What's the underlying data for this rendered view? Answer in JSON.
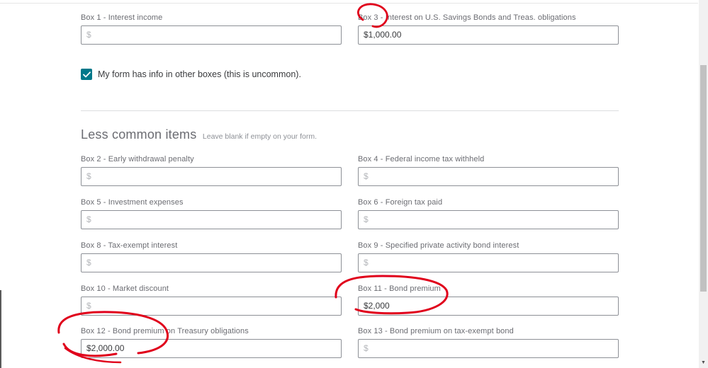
{
  "top_fields": [
    {
      "label": "Box 1 - Interest income",
      "value": "$",
      "empty": true
    },
    {
      "label": "Box 3 - Interest on U.S. Savings Bonds and Treas. obligations",
      "value": "$1,000.00",
      "empty": false
    }
  ],
  "checkbox": {
    "checked": true,
    "label": "My form has info in other boxes (this is uncommon)."
  },
  "section": {
    "title": "Less common items",
    "subtitle": "Leave blank if empty on your form."
  },
  "fields": {
    "box2": {
      "label": "Box 2 - Early withdrawal penalty",
      "value": "$"
    },
    "box4": {
      "label": "Box 4 - Federal income tax withheld",
      "value": "$"
    },
    "box5": {
      "label": "Box 5 - Investment expenses",
      "value": "$"
    },
    "box6": {
      "label": "Box 6 - Foreign tax paid",
      "value": "$"
    },
    "box8": {
      "label": "Box 8 - Tax-exempt interest",
      "value": "$"
    },
    "box9": {
      "label": "Box 9 - Specified private activity bond interest",
      "value": "$"
    },
    "box10": {
      "label": "Box 10 - Market discount",
      "value": "$"
    },
    "box11": {
      "label": "Box 11 - Bond premium",
      "value": "$2,000"
    },
    "box12": {
      "label": "Box 12 - Bond premium on Treasury obligations",
      "value": "$2,000.00"
    },
    "box13": {
      "label": "Box 13 - Bond premium on tax-exempt bond",
      "value": "$"
    }
  },
  "colors": {
    "accent": "#00788a",
    "annotation": "#e0001b",
    "input_border": "#8d9096"
  },
  "icons": {
    "checkbox": "checkmark-icon",
    "scroll": "chevron-down-icon"
  }
}
